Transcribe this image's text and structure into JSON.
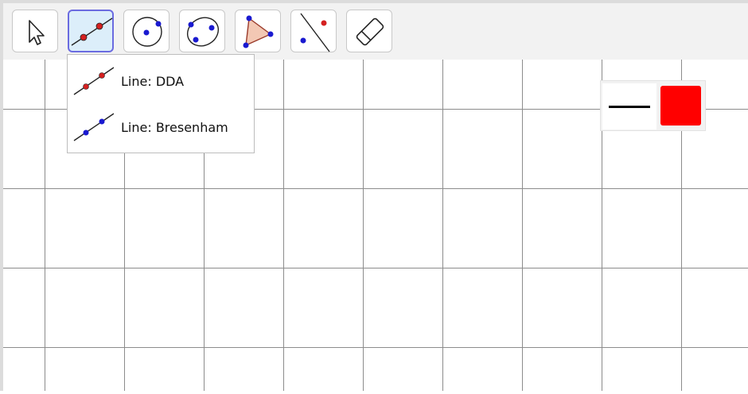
{
  "toolbar": {
    "tools": [
      {
        "id": "select",
        "icon": "arrow-cursor-icon",
        "active": false
      },
      {
        "id": "line",
        "icon": "line-two-points-icon",
        "active": true
      },
      {
        "id": "circle",
        "icon": "circle-center-point-icon",
        "active": false
      },
      {
        "id": "ellipse",
        "icon": "ellipse-three-points-icon",
        "active": false
      },
      {
        "id": "polygon",
        "icon": "polygon-icon",
        "active": false
      },
      {
        "id": "reflect",
        "icon": "reflect-line-icon",
        "active": false
      },
      {
        "id": "eraser",
        "icon": "eraser-icon",
        "active": false
      }
    ]
  },
  "line_menu": {
    "items": [
      {
        "label": "Line: DDA",
        "icon": "line-dda-icon",
        "point_color": "#d42020"
      },
      {
        "label": "Line: Bresenham",
        "icon": "line-bresenham-icon",
        "point_color": "#1a1ad0"
      }
    ]
  },
  "style_panel": {
    "line_style": "solid-line-icon",
    "color": "#ff0000"
  },
  "colors": {
    "active_border": "#6b6be0",
    "active_bg": "#dceefa",
    "grid": "#8c8c8c",
    "point_red": "#d42020",
    "point_blue": "#1a1ad0"
  }
}
